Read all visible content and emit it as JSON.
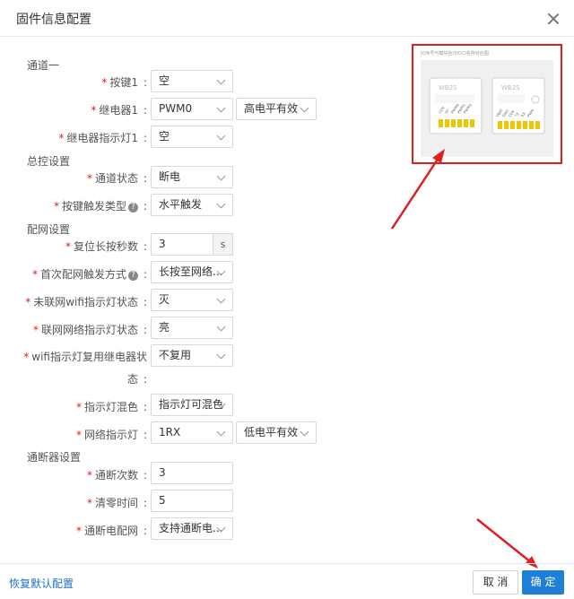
{
  "dialog": {
    "title": "固件信息配置"
  },
  "sections": {
    "channel": "通道一",
    "master": "总控设置",
    "network": "配网设置",
    "switch": "通断器设置"
  },
  "fields": {
    "key1": {
      "label": "按键1",
      "value": "空"
    },
    "relay1": {
      "label": "继电器1",
      "value": "PWM0",
      "level": "高电平有效"
    },
    "relay_led1": {
      "label": "继电器指示灯1",
      "value": "空"
    },
    "channel_state": {
      "label": "通道状态",
      "value": "断电"
    },
    "key_trigger": {
      "label": "按键触发类型",
      "value": "水平触发",
      "help": "?"
    },
    "reset_seconds": {
      "label": "复位长按秒数",
      "value": "3",
      "unit": "s"
    },
    "first_trigger": {
      "label": "首次配网触发方式",
      "value": "长按至网络...",
      "help": "?"
    },
    "not_connected_led": {
      "label": "未联网wifi指示灯状态",
      "value": "灭"
    },
    "connected_led": {
      "label": "联网网络指示灯状态",
      "value": "亮"
    },
    "wifi_led_reuse": {
      "label_line1": "wifi指示灯复用继电器状",
      "label_line2": "态",
      "value": "不复用"
    },
    "led_mix": {
      "label": "指示灯混色",
      "value": "指示灯可混色"
    },
    "network_led": {
      "label": "网络指示灯",
      "value": "1RX",
      "level": "低电平有效"
    },
    "toggle_count": {
      "label": "通断次数",
      "value": "3"
    },
    "clear_time": {
      "label": "清零时间",
      "value": "5"
    },
    "toggle_network": {
      "label": "通断电配网",
      "value": "支持通断电..."
    }
  },
  "preview": {
    "caption": "IO序号与模块丝印IO口名称对应图",
    "module_left": "WB2S",
    "module_right": "WB2S",
    "pins_left": [
      "CEN",
      "IO",
      "PWM0",
      "PWM1",
      "PWM2"
    ],
    "pins_right": [
      "VBAT",
      "GND",
      "CEN",
      "TX",
      "RX",
      "PWM"
    ]
  },
  "footer": {
    "reset_label": "恢复默认配置",
    "cancel_label": "取 消",
    "ok_label": "确 定"
  },
  "colors": {
    "accent": "#1e7fd6",
    "required": "#e02020",
    "highlight": "#e02020"
  }
}
